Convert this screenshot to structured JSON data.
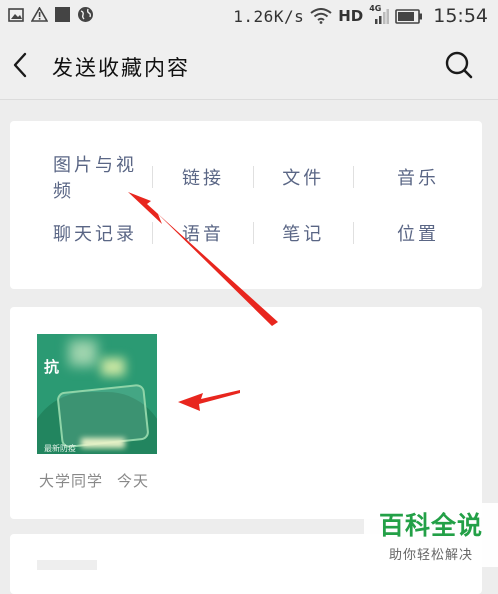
{
  "status_bar": {
    "net_speed": "1.26K/s",
    "network": "HD",
    "signal_label": "4G",
    "time": "15:54"
  },
  "header": {
    "title": "发送收藏内容"
  },
  "categories": {
    "row1": [
      "图片与视频",
      "链接",
      "文件",
      "音乐"
    ],
    "row2": [
      "聊天记录",
      "语音",
      "笔记",
      "位置"
    ]
  },
  "favorite_item": {
    "thumb_text": "抗",
    "thumb_footer": "最新防疫",
    "source": "大学同学",
    "date": "今天"
  },
  "watermark": {
    "title": "百科全说",
    "subtitle": "助你轻松解决"
  },
  "colors": {
    "background": "#ededed",
    "category_text": "#5a6685",
    "arrow": "#e8261e",
    "watermark_green": "#23a047",
    "thumbnail_green": "#2b9a73"
  }
}
